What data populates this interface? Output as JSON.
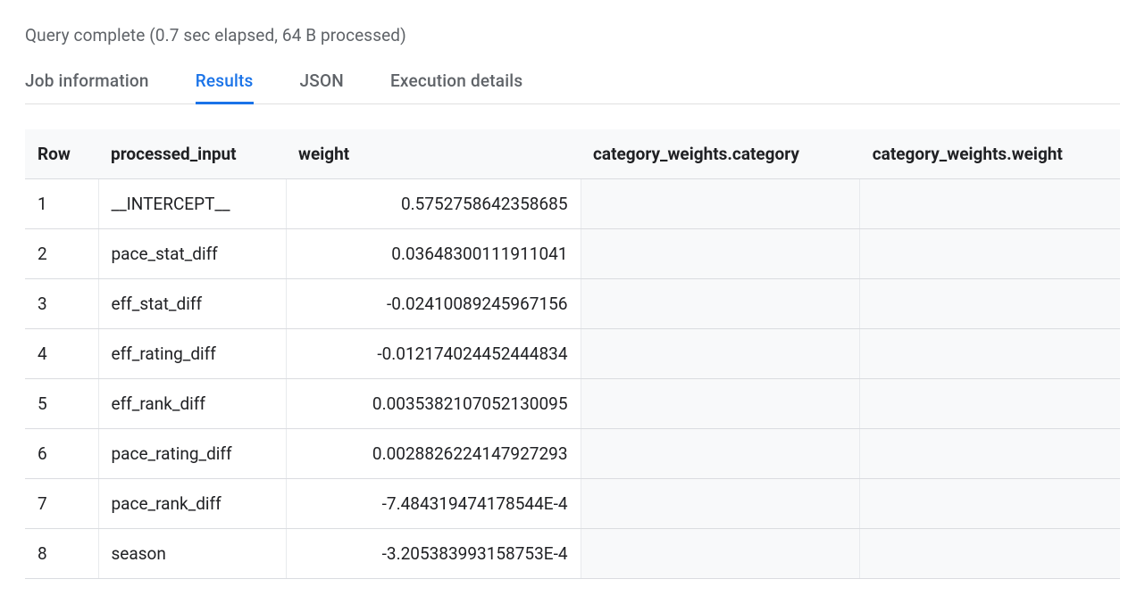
{
  "status": {
    "text": "Query complete (0.7 sec elapsed, 64 B processed)"
  },
  "tabs": {
    "items": [
      {
        "label": "Job information",
        "active": false
      },
      {
        "label": "Results",
        "active": true
      },
      {
        "label": "JSON",
        "active": false
      },
      {
        "label": "Execution details",
        "active": false
      }
    ]
  },
  "table": {
    "headers": {
      "row": "Row",
      "processed_input": "processed_input",
      "weight": "weight",
      "cat_category": "category_weights.category",
      "cat_weight": "category_weights.weight"
    },
    "rows": [
      {
        "idx": "1",
        "processed_input": "__INTERCEPT__",
        "weight": "0.5752758642358685",
        "cat_category": "",
        "cat_weight": ""
      },
      {
        "idx": "2",
        "processed_input": "pace_stat_diff",
        "weight": "0.03648300111911041",
        "cat_category": "",
        "cat_weight": ""
      },
      {
        "idx": "3",
        "processed_input": "eff_stat_diff",
        "weight": "-0.02410089245967156",
        "cat_category": "",
        "cat_weight": ""
      },
      {
        "idx": "4",
        "processed_input": "eff_rating_diff",
        "weight": "-0.012174024452444834",
        "cat_category": "",
        "cat_weight": ""
      },
      {
        "idx": "5",
        "processed_input": "eff_rank_diff",
        "weight": "0.0035382107052130095",
        "cat_category": "",
        "cat_weight": ""
      },
      {
        "idx": "6",
        "processed_input": "pace_rating_diff",
        "weight": "0.0028826224147927293",
        "cat_category": "",
        "cat_weight": ""
      },
      {
        "idx": "7",
        "processed_input": "pace_rank_diff",
        "weight": "-7.484319474178544E-4",
        "cat_category": "",
        "cat_weight": ""
      },
      {
        "idx": "8",
        "processed_input": "season",
        "weight": "-3.205383993158753E-4",
        "cat_category": "",
        "cat_weight": ""
      }
    ]
  }
}
